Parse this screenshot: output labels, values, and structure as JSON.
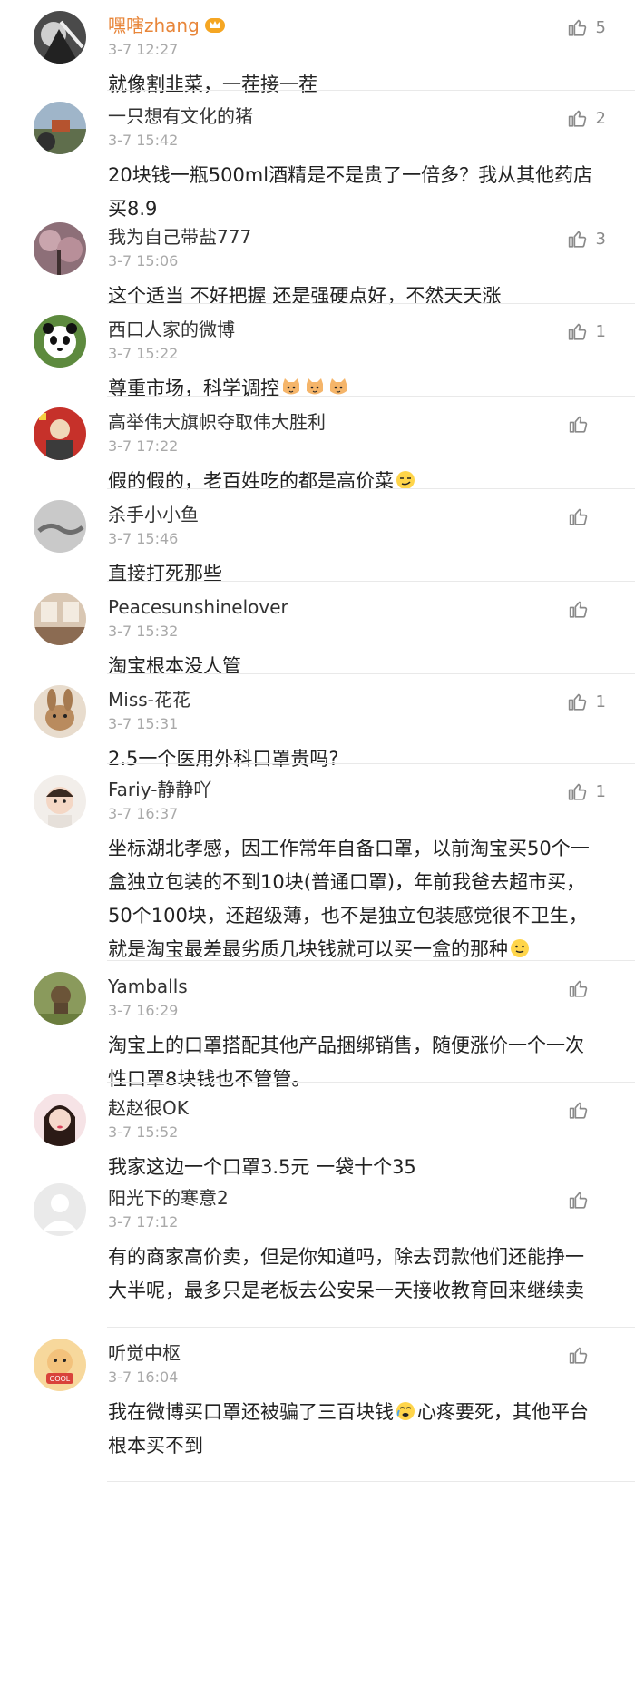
{
  "comments": [
    {
      "name": "嘿嗐zhang",
      "vip": true,
      "highlight": true,
      "time": "3-7 12:27",
      "likes": "5",
      "body": [
        {
          "t": "就像割韭菜，一茬接一茬"
        }
      ],
      "avatar": "dark-face"
    },
    {
      "name": "一只想有文化的猪",
      "time": "3-7 15:42",
      "likes": "2",
      "body": [
        {
          "t": "20块钱一瓶500ml酒精是不是贵了一倍多？我从其他药店买8.9"
        }
      ],
      "avatar": "scenery"
    },
    {
      "name": "我为自己带盐777",
      "time": "3-7 15:06",
      "likes": "3",
      "body": [
        {
          "t": "这个适当 不好把握   还是强硬点好，不然天天涨"
        }
      ],
      "avatar": "blossom"
    },
    {
      "name": "西口人家的微博",
      "time": "3-7 15:22",
      "likes": "1",
      "body": [
        {
          "t": "尊重市场，科学调控"
        },
        {
          "e": "cat"
        },
        {
          "e": "cat"
        },
        {
          "e": "cat"
        }
      ],
      "avatar": "panda"
    },
    {
      "name": "高举伟大旗帜夺取伟大胜利",
      "time": "3-7 17:22",
      "likes": "",
      "body": [
        {
          "t": "假的假的，老百姓吃的都是高价菜"
        },
        {
          "e": "smirk"
        }
      ],
      "avatar": "poster"
    },
    {
      "name": "杀手小小鱼",
      "time": "3-7 15:46",
      "likes": "",
      "body": [
        {
          "t": "直接打死那些"
        }
      ],
      "avatar": "fog"
    },
    {
      "name": "Peacesunshinelover",
      "time": "3-7 15:32",
      "likes": "",
      "body": [
        {
          "t": "淘宝根本没人管"
        }
      ],
      "avatar": "room"
    },
    {
      "name": "Miss-花花",
      "time": "3-7 15:31",
      "likes": "1",
      "body": [
        {
          "t": "2.5一个医用外科口罩贵吗?"
        }
      ],
      "avatar": "rabbit"
    },
    {
      "name": "Fariy-静静吖",
      "time": "3-7 16:37",
      "likes": "1",
      "body": [
        {
          "t": "坐标湖北孝感，因工作常年自备口罩，以前淘宝买50个一盒独立包装的不到10块(普通口罩)，年前我爸去超市买，50个100块，还超级薄，也不是独立包装感觉很不卫生，就是淘宝最差最劣质几块钱就可以买一盒的那种"
        },
        {
          "e": "smile"
        }
      ],
      "avatar": "baby"
    },
    {
      "name": "Yamballs",
      "time": "3-7 16:29",
      "likes": "",
      "body": [
        {
          "t": "淘宝上的口罩搭配其他产品捆绑销售，随便涨价一个一次性口罩8块钱也不管管。"
        }
      ],
      "avatar": "grass"
    },
    {
      "name": "赵赵很OK",
      "time": "3-7 15:52",
      "likes": "",
      "body": [
        {
          "t": "我家这边一个口罩3.5元 一袋十个35"
        }
      ],
      "avatar": "girl"
    },
    {
      "name": "阳光下的寒意2",
      "time": "3-7 17:12",
      "likes": "",
      "body": [
        {
          "t": "有的商家高价卖，但是你知道吗，除去罚款他们还能挣一大半呢，最多只是老板去公安呆一天接收教育回来继续卖"
        }
      ],
      "avatar": "default"
    },
    {
      "name": "听觉中枢",
      "time": "3-7 16:04",
      "likes": "",
      "body": [
        {
          "t": "我在微博买口罩还被骗了三百块钱"
        },
        {
          "e": "cry"
        },
        {
          "t": "心疼要死，其他平台根本买不到"
        }
      ],
      "avatar": "cool"
    }
  ]
}
